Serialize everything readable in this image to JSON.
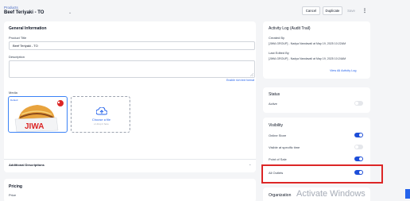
{
  "breadcrumb": "Products",
  "page_title": "Beef Teriyaki - TO",
  "toolbar": {
    "cancel": "Cancel",
    "duplicate": "Duplicate",
    "save": "Save",
    "more": "⋮"
  },
  "general": {
    "heading": "General Information",
    "title_label": "Product Title",
    "title_value": "Beef Teriyaki - TO",
    "description_label": "Description",
    "rich_text_link": "Enable rich text format",
    "media_label": "Media",
    "default_badge": "Default",
    "upload_title": "Choose a file",
    "upload_hint": "or drop it here",
    "image_text": "JIWA"
  },
  "additional": {
    "label": "Additional Descriptions"
  },
  "pricing": {
    "heading": "Pricing",
    "price_label": "Price"
  },
  "activity": {
    "heading": "Activity Log (Audit Trail)",
    "created_label": "Created By",
    "created_value": "[JIWA GROUP] - Nadya Nandavali at May 19, 2025 10:22AM",
    "edited_label": "Last Edited By",
    "edited_value": "[JIWA GROUP] - Nadya Nandavali at May 19, 2025 10:24AM",
    "view_all": "View All Activity Log"
  },
  "status": {
    "heading": "Status",
    "active_label": "Active",
    "active_on": false
  },
  "visibility": {
    "heading": "Visibility",
    "items": [
      {
        "label": "Online Store",
        "on": true
      },
      {
        "label": "Visible at specific time",
        "on": false
      },
      {
        "label": "Point of Sale",
        "on": true
      },
      {
        "label": "All Outlets",
        "on": true
      }
    ]
  },
  "organization": {
    "heading": "Organization"
  },
  "watermark": "Activate Windows",
  "colors": {
    "accent": "#1d4ed8",
    "highlight": "#dc2626",
    "link": "#2563eb"
  }
}
